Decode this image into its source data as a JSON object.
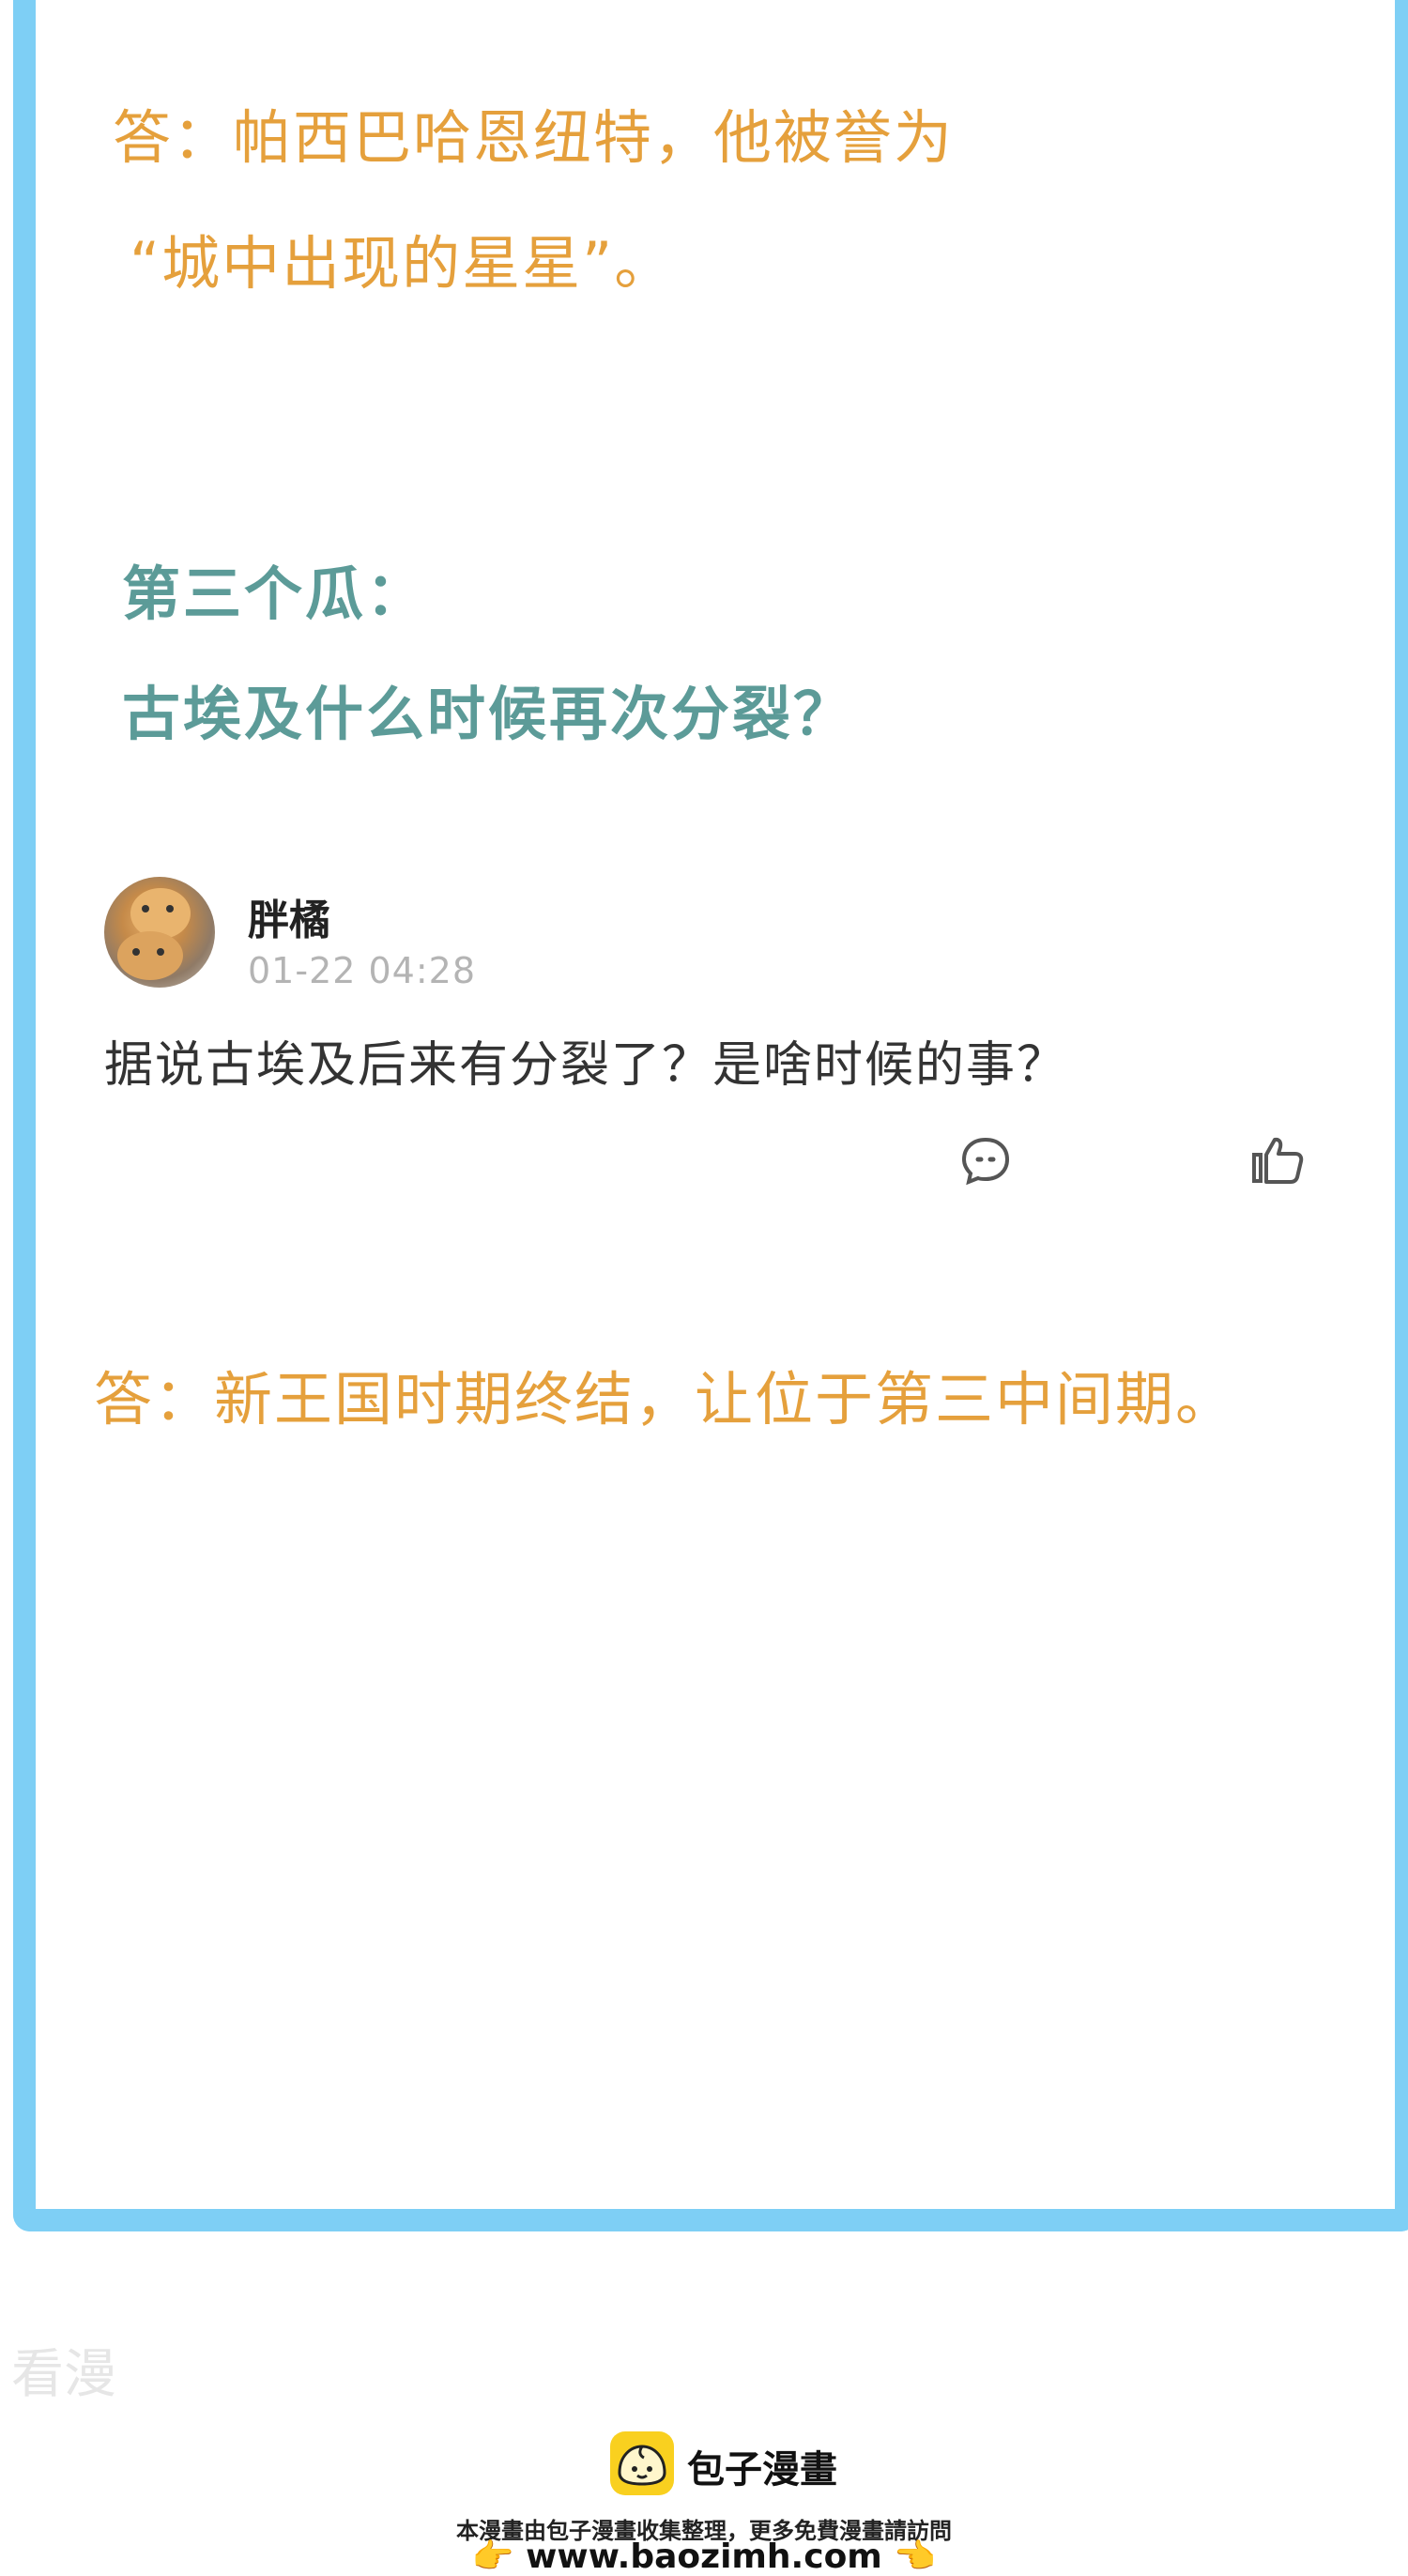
{
  "answer1": {
    "line1": "答：帕西巴哈恩纽特，他被誉为",
    "line2": "“城中出现的星星”。"
  },
  "question": {
    "heading": "第三个瓜：",
    "text": "古埃及什么时候再次分裂？"
  },
  "post": {
    "username": "胖橘",
    "timestamp": "01-22 04:28",
    "comment": "据说古埃及后来有分裂了？是啥时候的事？",
    "comment_icon": "comment-icon",
    "like_icon": "thumbs-up-icon"
  },
  "answer2": {
    "text": "答：新王国时期终结，让位于第三中间期。"
  },
  "watermark": {
    "side_text": "看漫"
  },
  "footer": {
    "brand": "包子漫畫",
    "notice": "本漫畫由包子漫畫收集整理，更多免費漫畫請訪問",
    "url": "www.baozimh.com",
    "hand_left": "👉",
    "hand_right": "👈"
  },
  "colors": {
    "frame": "#7ecff5",
    "answer": "#e5a03c",
    "question": "#5c9b98",
    "brand_yellow": "#f9d01f"
  }
}
